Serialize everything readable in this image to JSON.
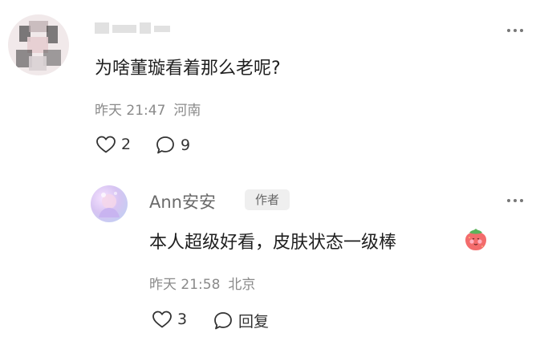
{
  "comment": {
    "username": "",
    "text": "为啥董璇看着那么老呢?",
    "time": "昨天 21:47",
    "location": "河南",
    "likes": "2",
    "replies": "9"
  },
  "reply": {
    "username": "Ann安安",
    "badge": "作者",
    "text": "本人超级好看，皮肤状态一级棒",
    "emoji": "strawberry-blush-emoji",
    "time": "昨天 21:58",
    "location": "北京",
    "likes": "3",
    "reply_label": "回复"
  },
  "icons": [
    "more-icon",
    "heart-icon",
    "comment-icon"
  ],
  "colors": {
    "text": "#1f1f1f",
    "meta": "#8a8a8a",
    "badge_bg": "#efefef"
  }
}
